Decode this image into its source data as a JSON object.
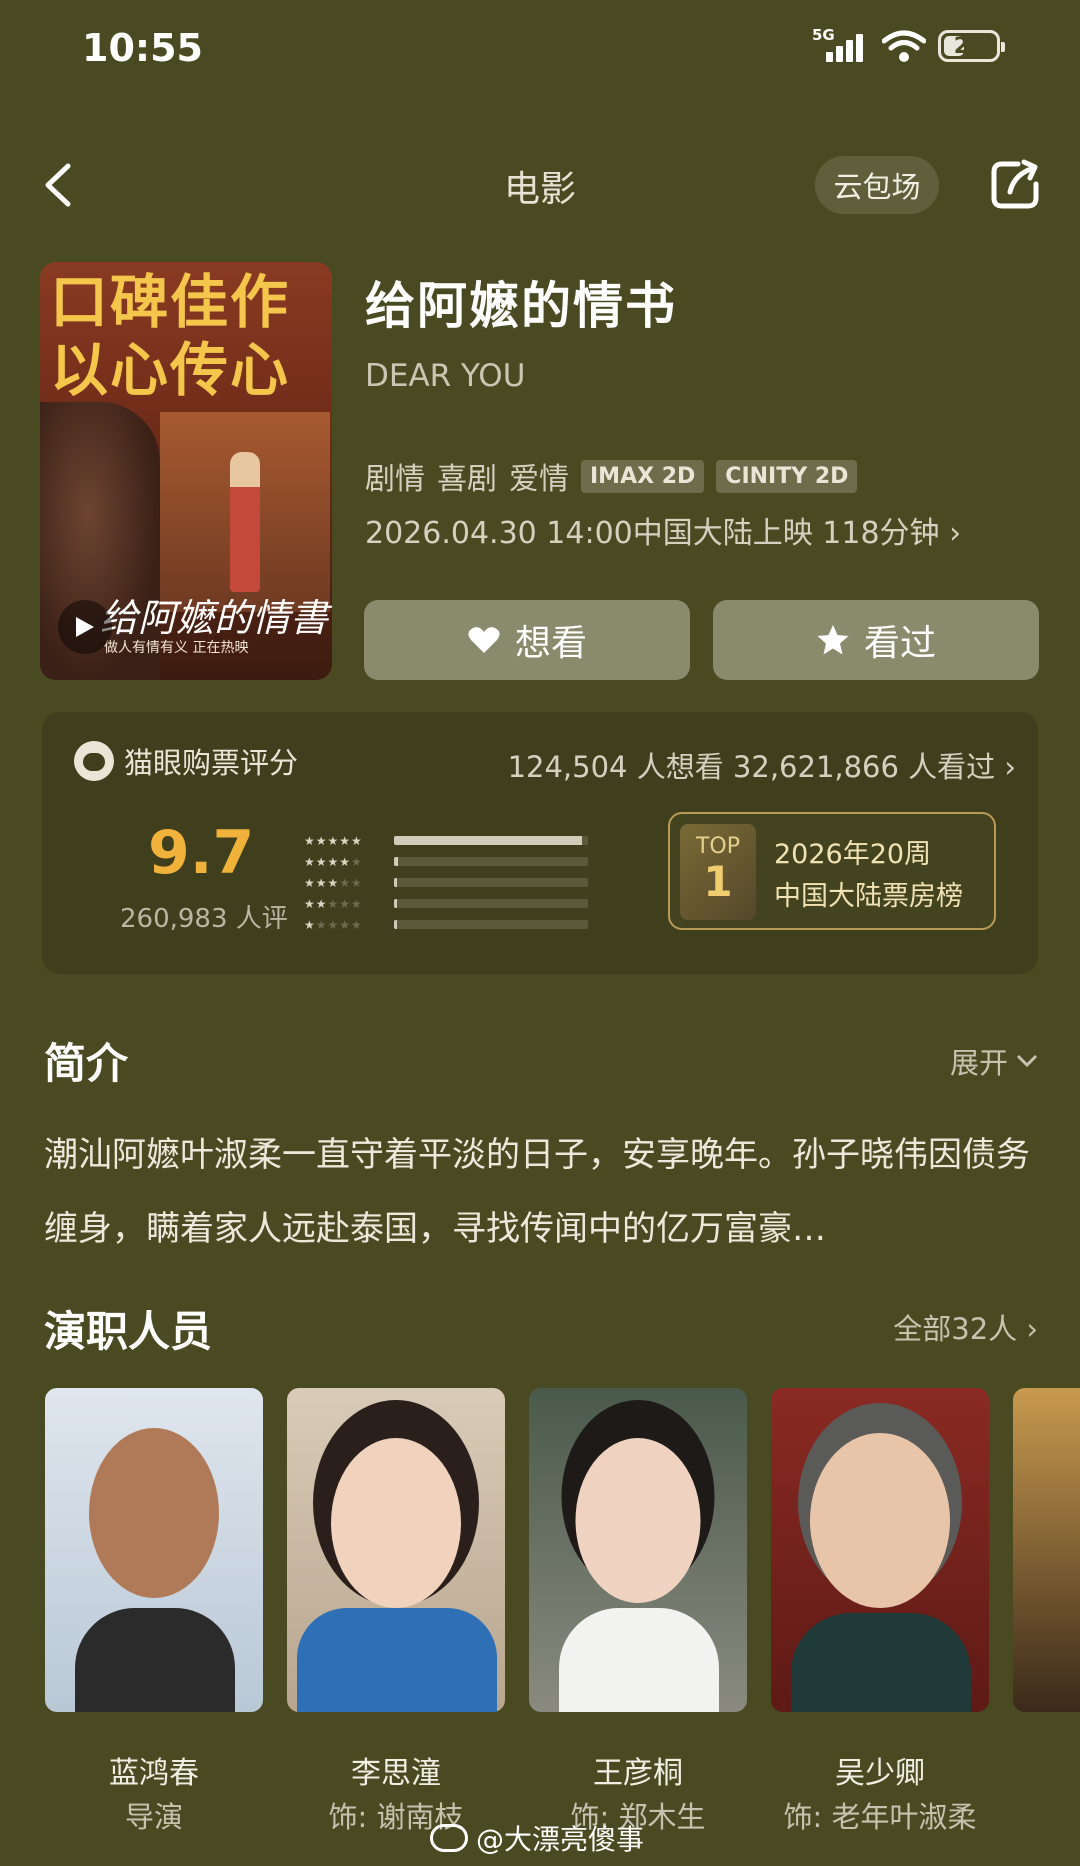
{
  "status": {
    "time": "10:55",
    "network": "5G",
    "battery": "29"
  },
  "nav": {
    "title": "电影",
    "cloud_button": "云包场"
  },
  "movie": {
    "poster_headline": [
      "口碑佳作",
      "以心传心"
    ],
    "poster_script": "给阿嬷的情書",
    "poster_tagline": "做人有情有义 正在热映",
    "title": "给阿嬷的情书",
    "english_title": "DEAR YOU",
    "genres": [
      "剧情",
      "喜剧",
      "爱情"
    ],
    "formats": [
      "IMAX 2D",
      "CINITY 2D"
    ],
    "release": "2026.04.30 14:00中国大陆上映 118分钟 ›",
    "want_button": "想看",
    "seen_button": "看过"
  },
  "rating": {
    "source": "猫眼购票评分",
    "counts": "124,504 人想看  32,621,866 人看过 ›",
    "score": "9.7",
    "raters": "260,983 人评",
    "distribution": [
      0.97,
      0.02,
      0.01,
      0.005,
      0.005
    ],
    "top_label": "TOP",
    "top_rank": "1",
    "top_line1": "2026年20周",
    "top_line2": "中国大陆票房榜"
  },
  "intro": {
    "title": "简介",
    "expand": "展开",
    "text": "潮汕阿嬷叶淑柔一直守着平淡的日子，安享晚年。孙子晓伟因债务缠身，瞒着家人远赴泰国，寻找传闻中的亿万富豪…"
  },
  "cast": {
    "title": "演职人员",
    "all": "全部32人 ›",
    "members": [
      {
        "name": "蓝鸿春",
        "role": "导演"
      },
      {
        "name": "李思潼",
        "role": "饰: 谢南枝"
      },
      {
        "name": "王彦桐",
        "role": "饰: 郑木生"
      },
      {
        "name": "吴少卿",
        "role": "饰: 老年叶淑柔"
      }
    ]
  },
  "watermark": "@大漂亮傻事",
  "colors": {
    "background": "#4a4a22",
    "score": "#f0b23a",
    "top_border": "#b89a55"
  }
}
